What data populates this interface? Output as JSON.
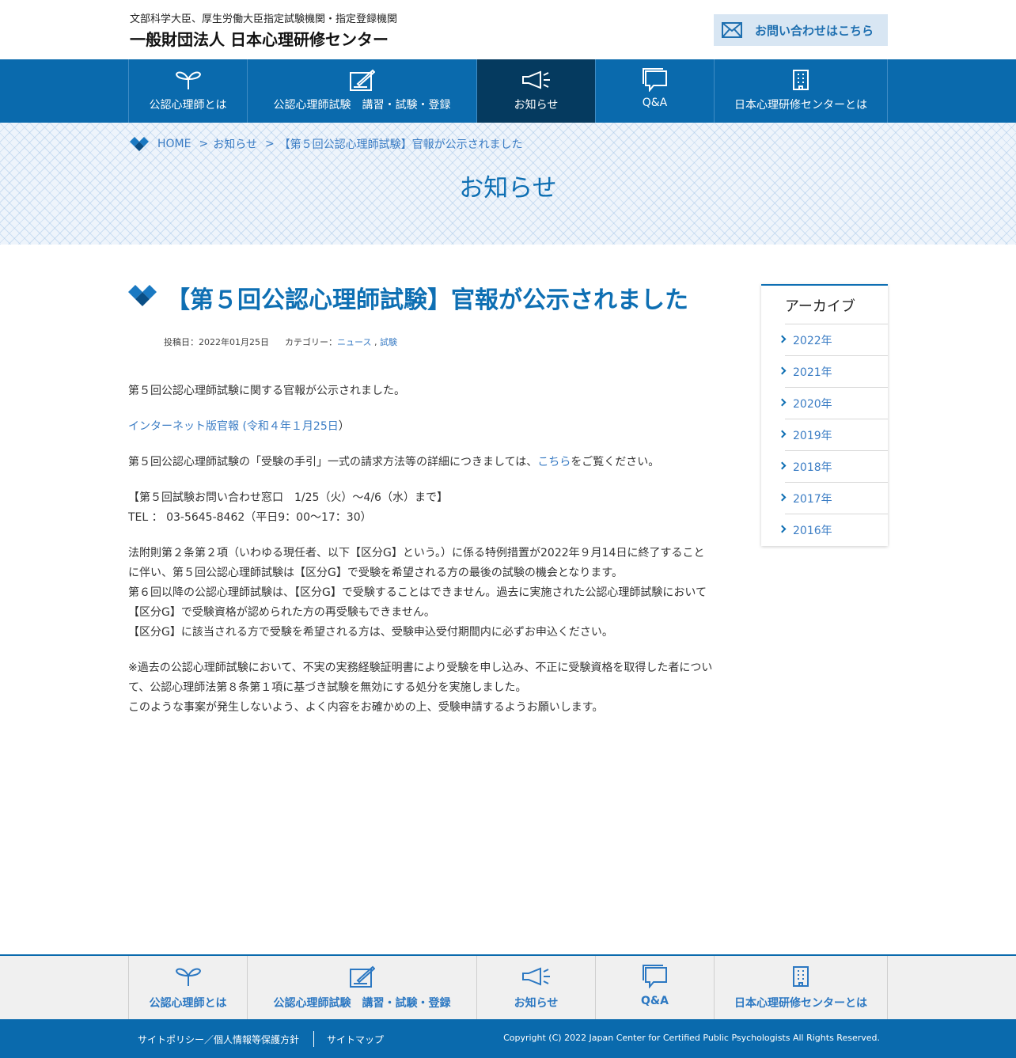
{
  "header": {
    "subtitle": "文部科学大臣、厚生労働大臣指定試験機関・指定登録機関",
    "org_name": "一般財団法人 日本心理研修センター",
    "contact_label": "お問い合わせはこちら"
  },
  "nav": {
    "items": [
      {
        "label": "公認心理師とは",
        "icon": "sprout-icon"
      },
      {
        "label": "公認心理師試験　講習・試験・登録",
        "icon": "pen-note-icon"
      },
      {
        "label": "お知らせ",
        "icon": "megaphone-icon"
      },
      {
        "label": "Q&A",
        "icon": "chat-bubbles-icon"
      },
      {
        "label": "日本心理研修センターとは",
        "icon": "building-icon"
      }
    ],
    "active_index": 2
  },
  "breadcrumb": {
    "home": "HOME",
    "sep": ">",
    "section": "お知らせ",
    "current": "【第５回公認心理師試験】官報が公示されました"
  },
  "hero": {
    "title": "お知らせ"
  },
  "article": {
    "title": "【第５回公認心理師試験】官報が公示されました",
    "posted_label": "投稿日：2022年01月25日",
    "category_label": "カテゴリー：",
    "categories": [
      "ニュース",
      "試験"
    ],
    "cat_sep": ",",
    "p1": "第５回公認心理師試験に関する官報が公示されました。",
    "link_kanpo": "インターネット版官報 (令和４年１月25日",
    "link_kanpo_close": "）",
    "p3_pre": "第５回公認心理師試験の「受験の手引」一式の請求方法等の詳細につきましては、",
    "p3_link": "こちら",
    "p3_post": "をご覧ください。",
    "contact_line1": "【第５回試験お問い合わせ窓口　1/25（火）～4/6（水）まで】",
    "contact_line2": "TEL ： 03-5645-8462（平日9：00～17：30）",
    "p5_line1": "法附則第２条第２項（いわゆる現任者、以下【区分G】という。）に係る特例措置が2022年９月14日に終了することに伴い、第５回公認心理師試験は【区分G】で受験を希望される方の最後の試験の機会となります。",
    "p5_line2": "第６回以降の公認心理師試験は、【区分G】で受験することはできません。過去に実施された公認心理師試験において【区分G】で受験資格が認められた方の再受験もできません。",
    "p5_line3": "【区分G】に該当される方で受験を希望される方は、受験申込受付期間内に必ずお申込ください。",
    "p6_line1": "※過去の公認心理師試験において、不実の実務経験証明書により受験を申し込み、不正に受験資格を取得した者について、公認心理師法第８条第１項に基づき試験を無効にする処分を実施しました。",
    "p6_line2": "このような事案が発生しないよう、よく内容をお確かめの上、受験申請するようお願いします。"
  },
  "sidebar": {
    "heading": "アーカイブ",
    "years": [
      "2022年",
      "2021年",
      "2020年",
      "2019年",
      "2018年",
      "2017年",
      "2016年"
    ]
  },
  "footer": {
    "policy": "サイトポリシー／個人情報等保護方針",
    "sitemap": "サイトマップ",
    "copyright": "Copyright (C) 2022 Japan Center for Certified Public Psychologists All Rights Reserved."
  },
  "colors": {
    "brand": "#0a6aad",
    "nav_active": "#053a5f",
    "link": "#3a7cc4",
    "contact_bg": "#d8e6f3"
  }
}
